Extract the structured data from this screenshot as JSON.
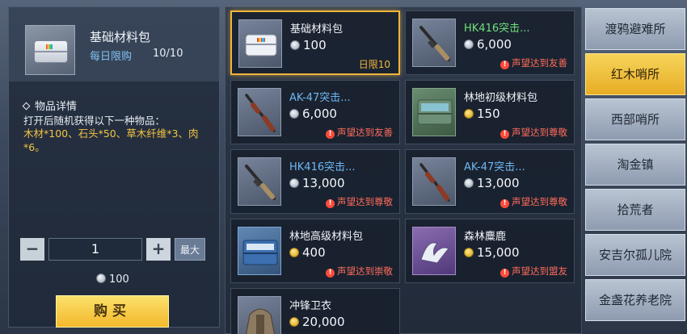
{
  "detail": {
    "title": "基础材料包",
    "limit_label": "每日限购",
    "limit_value": "10/10",
    "info_heading": "物品详情",
    "description": "打开后随机获得以下一种物品：",
    "items_text": "木材*100、石头*50、草木纤维*3、肉*6。",
    "quantity": "1",
    "minus": "−",
    "plus": "+",
    "max": "最大",
    "total": "100",
    "buy": "购买"
  },
  "shop_items": [
    {
      "name": "基础材料包",
      "price": "100",
      "currency": "silver",
      "note": "日限10",
      "note_type": "limit",
      "rarity": "white",
      "icon": "material-case-icon",
      "selected": true
    },
    {
      "name": "HK416突击...",
      "price": "6,000",
      "currency": "silver",
      "note": "声望达到友善",
      "note_type": "warn",
      "rarity": "green",
      "icon": "assault-rifle-icon"
    },
    {
      "name": "AK-47突击...",
      "price": "6,000",
      "currency": "silver",
      "note": "声望达到友善",
      "note_type": "warn",
      "rarity": "blue",
      "icon": "ak47-rifle-icon"
    },
    {
      "name": "林地初级材料包",
      "price": "150",
      "currency": "gold",
      "note": "声望达到尊敬",
      "note_type": "warn",
      "rarity": "white",
      "icon": "woodland-case-icon"
    },
    {
      "name": "HK416突击...",
      "price": "13,000",
      "currency": "silver",
      "note": "声望达到尊敬",
      "note_type": "warn",
      "rarity": "blue",
      "icon": "assault-rifle-icon"
    },
    {
      "name": "AK-47突击...",
      "price": "13,000",
      "currency": "silver",
      "note": "声望达到尊敬",
      "note_type": "warn",
      "rarity": "blue",
      "icon": "ak47-rifle-icon"
    },
    {
      "name": "林地高级材料包",
      "price": "400",
      "currency": "gold",
      "note": "声望达到崇敬",
      "note_type": "warn",
      "rarity": "white",
      "icon": "woodland-advanced-case-icon"
    },
    {
      "name": "森林麋鹿",
      "price": "15,000",
      "currency": "gold",
      "note": "声望达到盟友",
      "note_type": "warn",
      "rarity": "white",
      "icon": "antler-icon"
    },
    {
      "name": "冲锋卫衣",
      "price": "20,000",
      "currency": "gold",
      "note": "",
      "note_type": "",
      "rarity": "white",
      "icon": "hoodie-icon"
    }
  ],
  "tabs": [
    "渡鸦避难所",
    "红木哨所",
    "西部哨所",
    "淘金镇",
    "拾荒者",
    "安吉尔孤儿院",
    "金盏花养老院"
  ],
  "active_tab": 1
}
